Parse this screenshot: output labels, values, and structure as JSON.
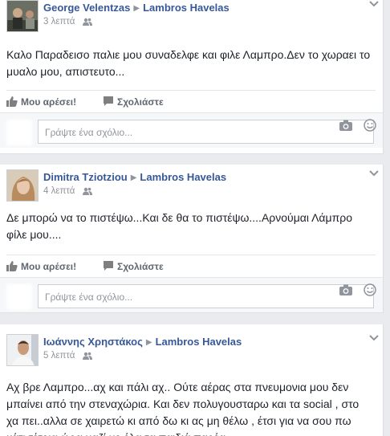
{
  "posts": [
    {
      "author": "George Velentzas",
      "target": "Lambros Havelas",
      "time": "3 λεπτά",
      "text_lines": [
        "Καλο Παραδεισο παλιε μου συναδελφε και φιλε Λαμπρο.Δεν το χωραει το",
        "μυαλο μου, απιστευτο..."
      ]
    },
    {
      "author": "Dimitra Tziotziou",
      "target": "Lambros Havelas",
      "time": "4 λεπτά",
      "text_lines": [
        "Δε μπορώ να το πιστέψω...Και δε θα το πιστέψω....Αρνούμαι Λάμπρο",
        "φίλε μου...."
      ]
    },
    {
      "author": "Ιωάννης Χρηστάκος",
      "target": "Lambros Havelas",
      "time": "5 λεπτά",
      "text_lines": [
        "Αχ βρε Λαμπρο...αχ και πάλι αχ.. Ούτε αέρας στα πνευμονια μου δεν",
        "μπαίνει από την στεναχώρια. Και δεν πολυγουσταρω και τα social , στο",
        "χα πει..αλλα σε χαιρετώ κι από δω κι ας μη θέλω , έτσι για να σου πω",
        "κάτι τέτοια ώρα μαζί με όλα τα παιδιά παρέα.."
      ]
    }
  ],
  "actions": {
    "like": "Μου αρέσει!",
    "comment": "Σχολιάστε"
  },
  "comment_placeholder": "Γράψτε ένα σχόλιο...",
  "icons": {
    "audience": "friends-icon",
    "options": "chevron-down-icon",
    "like": "thumbs-up-icon",
    "comment": "speech-bubble-icon",
    "camera": "camera-icon",
    "smiley": "smiley-icon"
  },
  "colors": {
    "link": "#365899",
    "muted": "#90949c",
    "action": "#616770",
    "background": "#e9ebee"
  }
}
